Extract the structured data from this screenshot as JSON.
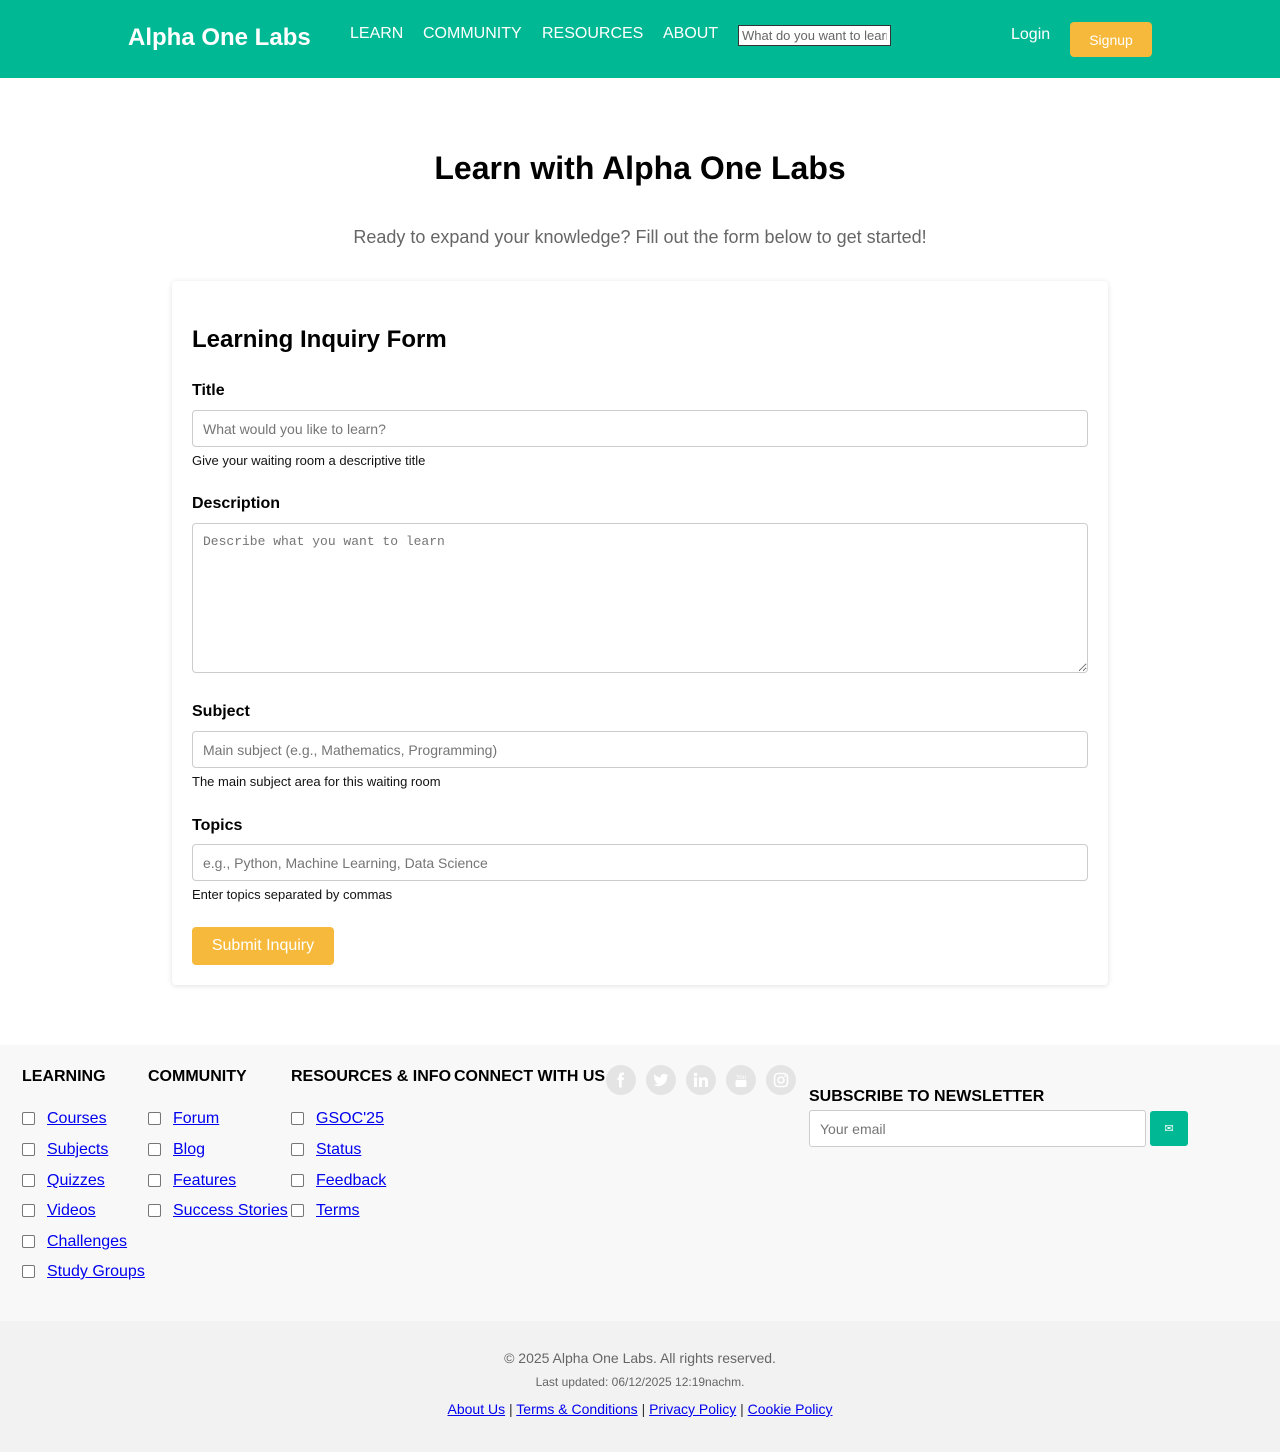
{
  "header": {
    "brand": "Alpha One Labs",
    "nav": [
      "LEARN",
      "COMMUNITY",
      "RESOURCES",
      "ABOUT"
    ],
    "search_placeholder": "What do you want to learn?",
    "login": "Login",
    "signup": "Signup"
  },
  "hero": {
    "title": "Learn with Alpha One Labs",
    "subtitle": "Ready to expand your knowledge? Fill out the form below to get started!"
  },
  "form": {
    "title": "Learning Inquiry Form",
    "title_label": "Title",
    "title_placeholder": "What would you like to learn?",
    "title_help": "Give your waiting room a descriptive title",
    "description_label": "Description",
    "description_placeholder": "Describe what you want to learn",
    "subject_label": "Subject",
    "subject_placeholder": "Main subject (e.g., Mathematics, Programming)",
    "subject_help": "The main subject area for this waiting room",
    "topics_label": "Topics",
    "topics_placeholder": "e.g., Python, Machine Learning, Data Science",
    "topics_help": "Enter topics separated by commas",
    "submit": "Submit Inquiry"
  },
  "footer": {
    "learning": {
      "title": "LEARNING",
      "links": [
        "Courses",
        "Subjects",
        "Quizzes",
        "Videos",
        "Challenges",
        "Study Groups"
      ]
    },
    "community": {
      "title": "COMMUNITY",
      "links": [
        "Forum",
        "Blog",
        "Features",
        "Success Stories"
      ]
    },
    "resources": {
      "title": "RESOURCES & INFO",
      "links": [
        "GSOC'25",
        "Status",
        "Feedback",
        "Terms"
      ]
    },
    "connect": {
      "title": "CONNECT WITH US",
      "icons": [
        "facebook-icon",
        "twitter-icon",
        "linkedin-icon",
        "youtube-icon",
        "instagram-icon"
      ]
    },
    "newsletter": {
      "title": "SUBSCRIBE TO NEWSLETTER",
      "placeholder": "Your email",
      "button_icon": "envelope-icon",
      "button_glyph": "✉"
    },
    "copyright": "© 2025 Alpha One Labs. All rights reserved.",
    "last_updated": "Last updated: 06/12/2025 12:19nachm.",
    "legal": [
      "About Us",
      "Terms & Conditions",
      "Privacy Policy",
      "Cookie Policy"
    ],
    "separator": "|"
  },
  "colors": {
    "brand": "#00b894",
    "accent": "#f6b93b",
    "link": "#0000ee"
  }
}
